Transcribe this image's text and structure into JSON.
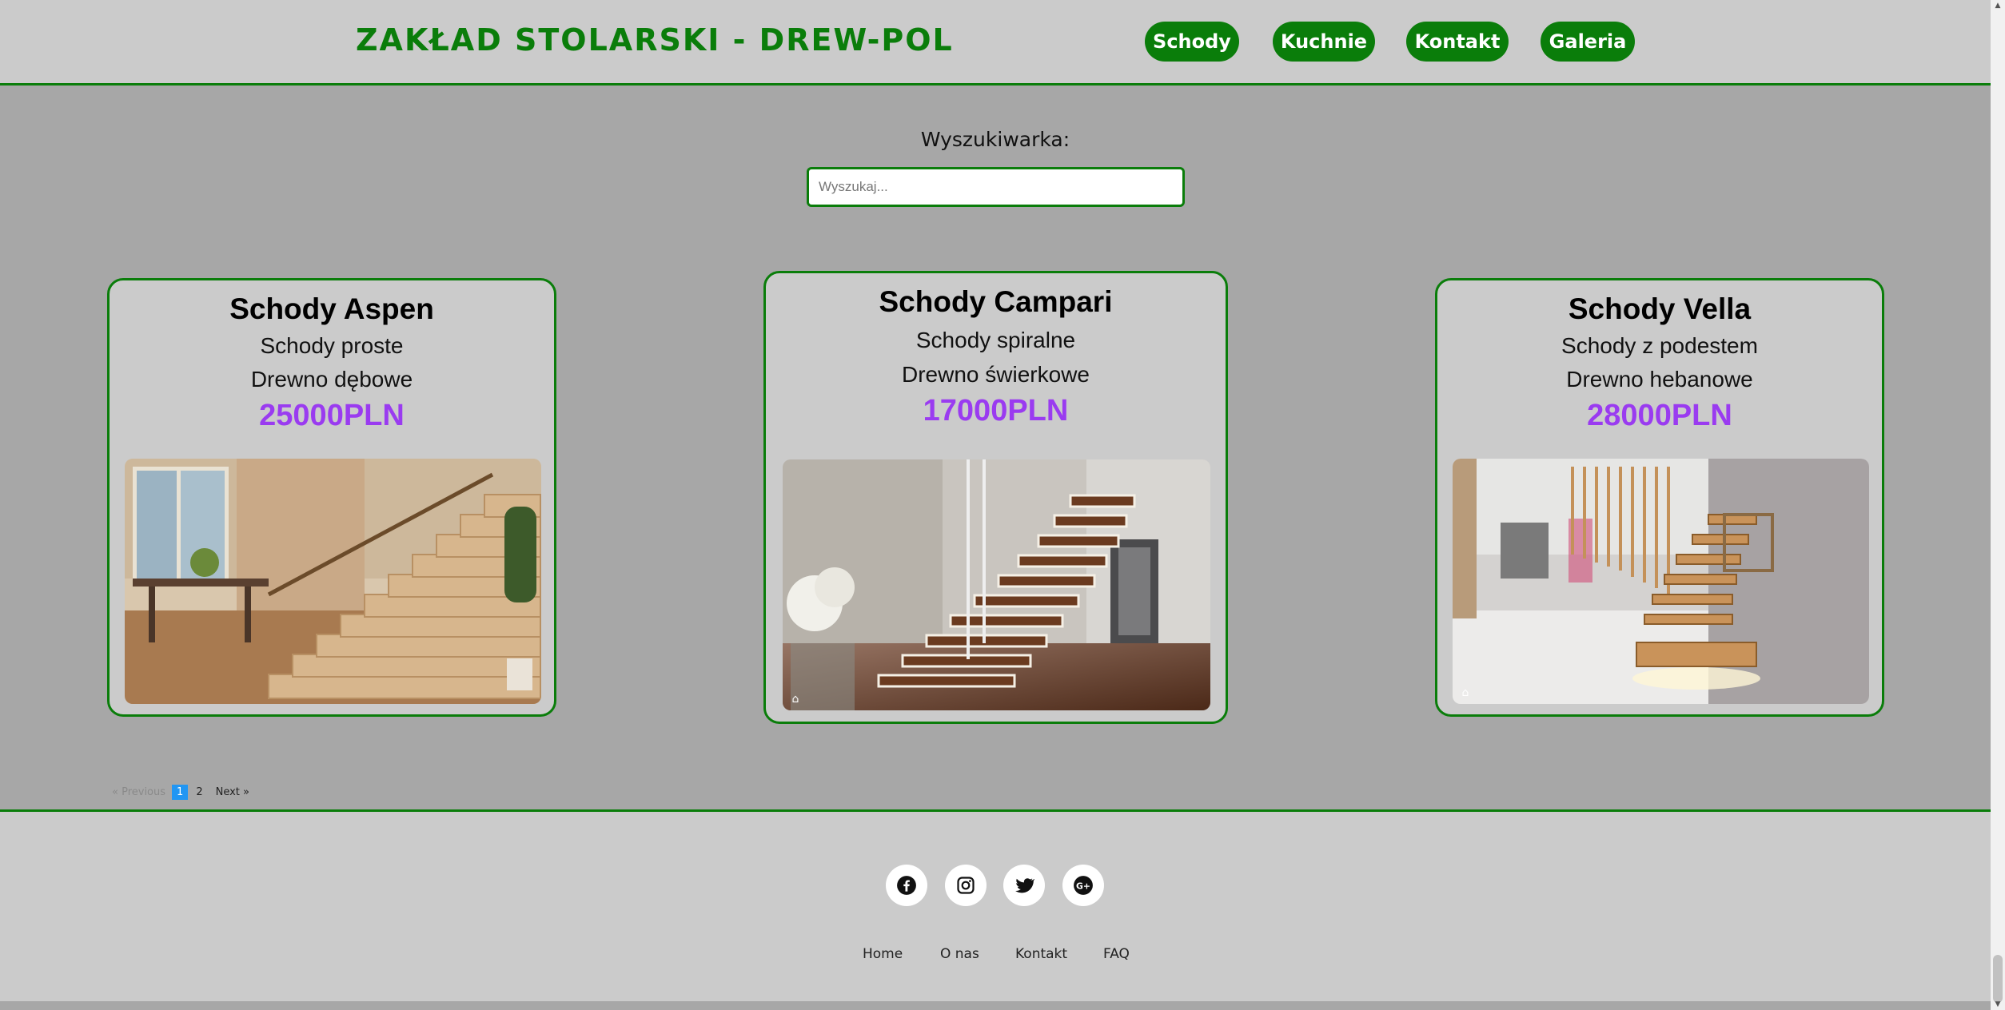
{
  "header": {
    "title": "ZAKŁAD STOLARSKI - DREW-POL",
    "nav": [
      {
        "label": "Schody"
      },
      {
        "label": "Kuchnie"
      },
      {
        "label": "Kontakt"
      },
      {
        "label": "Galeria"
      }
    ]
  },
  "search": {
    "label": "Wyszukiwarka:",
    "placeholder": "Wyszukaj..."
  },
  "products": [
    {
      "title": "Schody Aspen",
      "type": "Schody proste",
      "wood": "Drewno dębowe",
      "price": "25000PLN"
    },
    {
      "title": "Schody Campari",
      "type": "Schody spiralne",
      "wood": "Drewno świerkowe",
      "price": "17000PLN"
    },
    {
      "title": "Schody Vella",
      "type": "Schody z podestem",
      "wood": "Drewno hebanowe",
      "price": "28000PLN"
    }
  ],
  "pagination": {
    "prev": "« Previous",
    "pages": [
      "1",
      "2"
    ],
    "current": "1",
    "next": "Next »"
  },
  "footer": {
    "social_icons": [
      "facebook-icon",
      "instagram-icon",
      "twitter-icon",
      "google-plus-icon"
    ],
    "links": [
      "Home",
      "O nas",
      "Kontakt",
      "FAQ"
    ]
  },
  "colors": {
    "accent_green": "#0a7d0a",
    "price_purple": "#9a3bf0",
    "background": "#a7a7a7",
    "panel": "#cbcbcb",
    "pagination_active": "#2196f3"
  }
}
